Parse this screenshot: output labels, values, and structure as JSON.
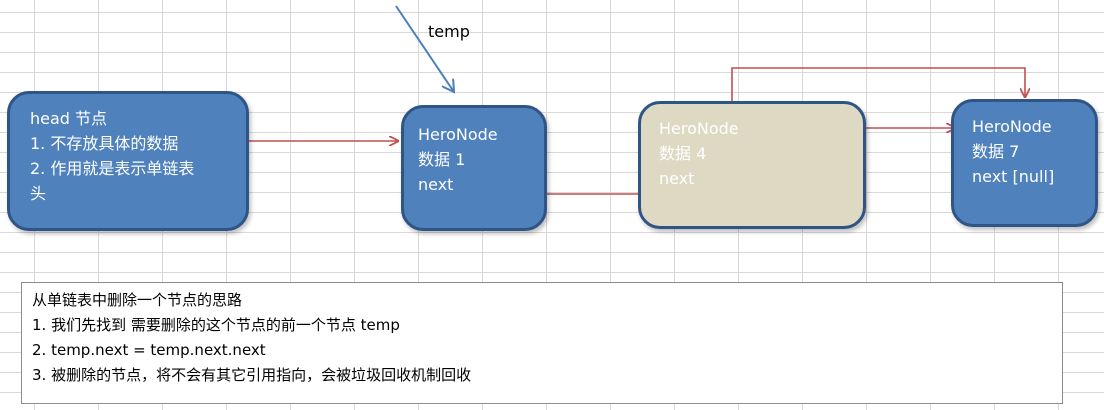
{
  "temp_label": "temp",
  "head_node": {
    "lines": [
      "head 节点",
      "1. 不存放具体的数据",
      "2. 作用就是表示单链表",
      "头"
    ]
  },
  "node_1": {
    "lines": [
      "HeroNode",
      "数据 1",
      "next"
    ]
  },
  "node_4": {
    "lines": [
      "HeroNode",
      "数据 4",
      "next"
    ]
  },
  "node_7": {
    "lines": [
      "HeroNode",
      "数据 7",
      "next [null]"
    ]
  },
  "notes": {
    "title": "从单链表中删除一个节点的思路",
    "items": [
      "1.  我们先找到 需要删除的这个节点的前一个节点 temp",
      "2.  temp.next = temp.next.next",
      "3. 被删除的节点，将不会有其它引用指向，会被垃圾回收机制回收"
    ]
  },
  "colors": {
    "node_fill": "#4f81bd",
    "node_border": "#2f5486",
    "deleted_node_fill": "#ddd9c3",
    "link_arrow": "#c0504d",
    "temp_arrow": "#4a7ebb"
  }
}
